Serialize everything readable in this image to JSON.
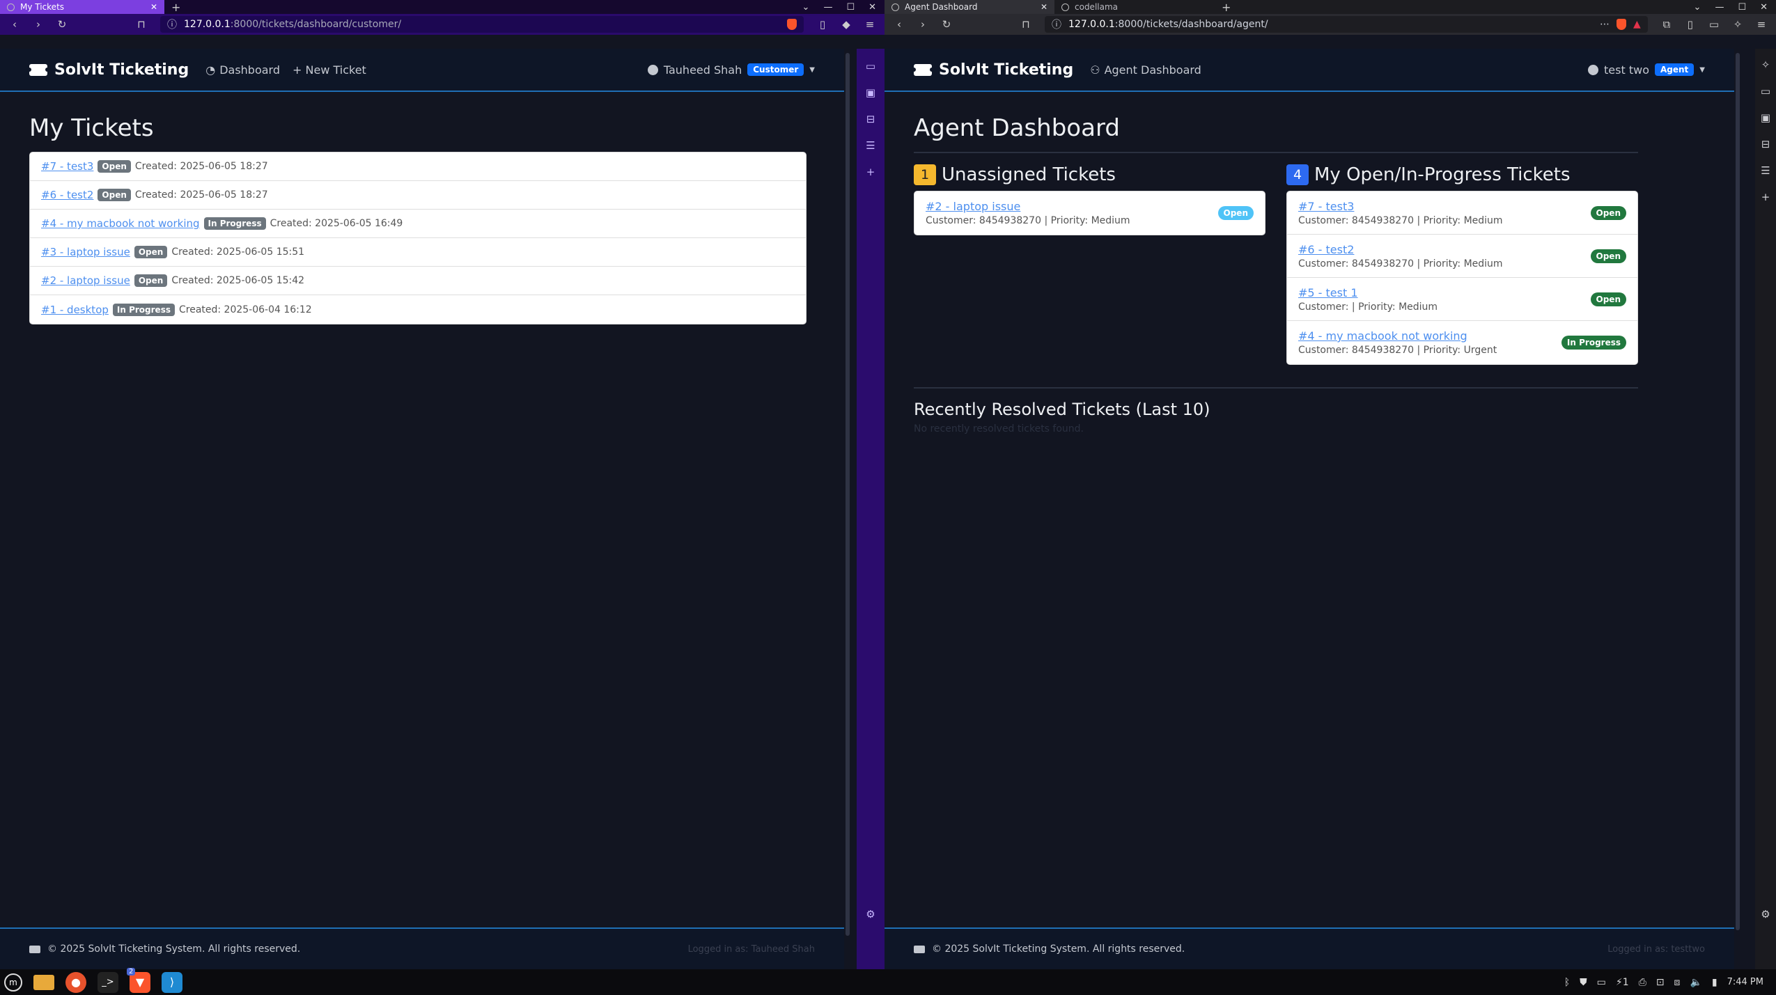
{
  "left": {
    "tab_title": "My Tickets",
    "url_host": "127.0.0.1",
    "url_path": ":8000/tickets/dashboard/customer/",
    "brand": "SolvIt Ticketing",
    "nav_dashboard": "Dashboard",
    "nav_new_ticket": "+ New Ticket",
    "user_name": "Tauheed Shah",
    "role": "Customer",
    "page_title": "My Tickets",
    "tickets": [
      {
        "link": "#7 - test3",
        "status": "Open",
        "created": "Created: 2025-06-05 18:27"
      },
      {
        "link": "#6 - test2",
        "status": "Open",
        "created": "Created: 2025-06-05 18:27"
      },
      {
        "link": "#4 - my macbook not working",
        "status": "In Progress",
        "created": "Created: 2025-06-05 16:49"
      },
      {
        "link": "#3 - laptop issue",
        "status": "Open",
        "created": "Created: 2025-06-05 15:51"
      },
      {
        "link": "#2 - laptop issue",
        "status": "Open",
        "created": "Created: 2025-06-05 15:42"
      },
      {
        "link": "#1 - desktop",
        "status": "In Progress",
        "created": "Created: 2025-06-04 16:12"
      }
    ],
    "footer": "© 2025 SolvIt Ticketing System. All rights reserved.",
    "footer_right": "Logged in as: Tauheed Shah"
  },
  "right": {
    "tab1_title": "Agent Dashboard",
    "tab2_title": "codellama",
    "url_host": "127.0.0.1",
    "url_path": ":8000/tickets/dashboard/agent/",
    "brand": "SolvIt Ticketing",
    "nav_agent_dashboard": "Agent Dashboard",
    "user_name": "test two",
    "role": "Agent",
    "page_title": "Agent Dashboard",
    "unassigned": {
      "count": "1",
      "heading": "Unassigned Tickets",
      "items": [
        {
          "link": "#2 - laptop issue",
          "meta": "Customer: 8454938270 | Priority: Medium",
          "status": "Open"
        }
      ]
    },
    "mine": {
      "count": "4",
      "heading": "My Open/In-Progress Tickets",
      "items": [
        {
          "link": "#7 - test3",
          "meta": "Customer: 8454938270 | Priority: Medium",
          "status": "Open"
        },
        {
          "link": "#6 - test2",
          "meta": "Customer: 8454938270 | Priority: Medium",
          "status": "Open"
        },
        {
          "link": "#5 - test 1",
          "meta": "Customer: | Priority: Medium",
          "status": "Open"
        },
        {
          "link": "#4 - my macbook not working",
          "meta": "Customer: 8454938270 | Priority: Urgent",
          "status": "In Progress"
        }
      ]
    },
    "resolved_heading": "Recently Resolved Tickets (Last 10)",
    "resolved_empty": "No recently resolved tickets found.",
    "footer": "© 2025 SolvIt Ticketing System. All rights reserved.",
    "footer_right": "Logged in as: testtwo"
  },
  "taskbar": {
    "badge_count": "2",
    "tray_count": "1",
    "clock": "7:44 PM"
  },
  "colors": {
    "accent_purple": "#7c3fe0",
    "navbar_bg": "#0e1627",
    "link": "#4d8fef",
    "badge_open_green": "#21783e",
    "unassigned_count": "#f5b82e",
    "mine_count": "#2d6af0"
  }
}
